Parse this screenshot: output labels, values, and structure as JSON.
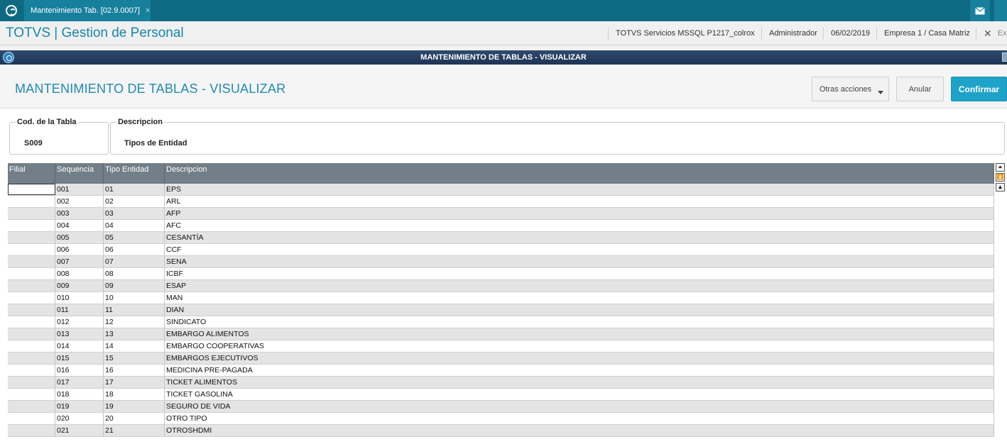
{
  "topbar": {
    "tab_label": "Mantenimiento Tab. [02.9.0007]",
    "tab_close": "×"
  },
  "appbar": {
    "title": "TOTVS | Gestion de Personal",
    "environment": "TOTVS Servicios MSSQL P1217_colrox",
    "user": "Administrador",
    "date": "06/02/2019",
    "company": "Empresa 1 / Casa Matriz",
    "exit_label": "Exi"
  },
  "window": {
    "title": "MANTENIMIENTO DE TABLAS - VISUALIZAR"
  },
  "header": {
    "page_title": "MANTENIMIENTO DE TABLAS - VISUALIZAR",
    "other_actions": "Otras acciones",
    "cancel": "Anular",
    "confirm": "Confirmar"
  },
  "fields": {
    "code_label": "Cod. de la Tabla",
    "code_value": "S009",
    "desc_label": "Descripcion",
    "desc_value": "Tipos de Entidad"
  },
  "grid": {
    "columns": [
      "Filial",
      "Sequencia",
      "Tipo Entidad",
      "Descripcion"
    ],
    "rows": [
      [
        "",
        "001",
        "01",
        "EPS"
      ],
      [
        "",
        "002",
        "02",
        "ARL"
      ],
      [
        "",
        "003",
        "03",
        "AFP"
      ],
      [
        "",
        "004",
        "04",
        "AFC"
      ],
      [
        "",
        "005",
        "05",
        "CESANTÍA"
      ],
      [
        "",
        "006",
        "06",
        "CCF"
      ],
      [
        "",
        "007",
        "07",
        "SENA"
      ],
      [
        "",
        "008",
        "08",
        "ICBF"
      ],
      [
        "",
        "009",
        "09",
        "ESAP"
      ],
      [
        "",
        "010",
        "10",
        "MAN"
      ],
      [
        "",
        "011",
        "11",
        "DIAN"
      ],
      [
        "",
        "012",
        "12",
        "SINDICATO"
      ],
      [
        "",
        "013",
        "13",
        "EMBARGO ALIMENTOS"
      ],
      [
        "",
        "014",
        "14",
        "EMBARGO COOPERATIVAS"
      ],
      [
        "",
        "015",
        "15",
        "EMBARGOS EJECUTIVOS"
      ],
      [
        "",
        "016",
        "16",
        "MEDICINA PRE-PAGADA"
      ],
      [
        "",
        "017",
        "17",
        "TICKET ALIMENTOS"
      ],
      [
        "",
        "018",
        "18",
        "TICKET GASOLINA"
      ],
      [
        "",
        "019",
        "19",
        "SEGURO DE VIDA"
      ],
      [
        "",
        "020",
        "20",
        "OTRO TIPO"
      ],
      [
        "",
        "021",
        "21",
        "OTROSHDMI"
      ]
    ]
  },
  "icons": {
    "logo": "totvs-logo-icon",
    "mail": "mail-icon",
    "exit": "close-icon",
    "window": "window-icon"
  }
}
